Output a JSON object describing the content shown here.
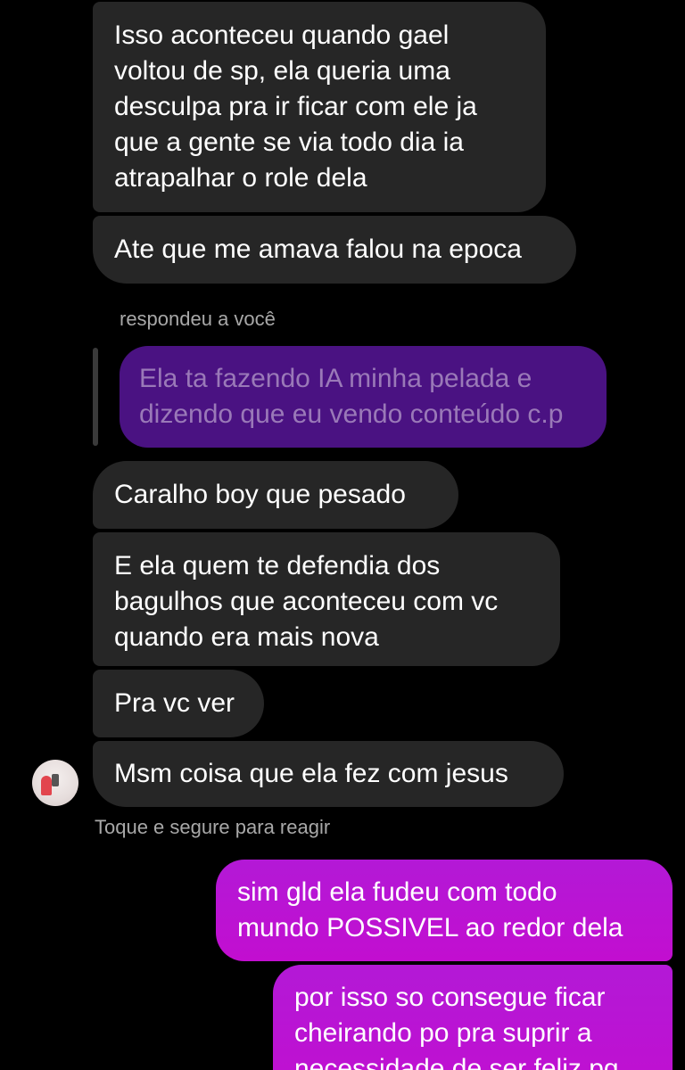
{
  "messages": {
    "m1": "Isso aconteceu quando gael\nvoltou de sp, ela queria uma\ndesculpa pra ir ficar com ele ja\nque a gente se via todo dia ia\natrapalhar o role dela",
    "m2": "Ate que me amava falou na epoca",
    "reply_label": "respondeu a você",
    "replied_message": "Ela ta fazendo IA minha pelada e\ndizendo que eu vendo conteúdo c.p",
    "m3": "Caralho boy que pesado",
    "m4": "E ela quem te defendia dos\nbagulhos que aconteceu com vc\nquando era mais nova",
    "m5": "Pra vc ver",
    "m6": "Msm coisa que ela fez com jesus",
    "react_hint": "Toque e segure para reagir",
    "m7": "sim gld ela fudeu com todo\nmundo POSSIVEL ao redor dela",
    "m8": "por isso so consegue ficar\ncheirando po pra suprir a\nnecessidade de ser feliz pq"
  },
  "colors": {
    "background": "#000000",
    "incoming_bubble": "#262626",
    "outgoing_bubble": "#c20ed0",
    "replied_bubble": "#4a1282",
    "meta_text": "#a8a8a8"
  },
  "icons": {
    "avatar": "contact-avatar"
  }
}
